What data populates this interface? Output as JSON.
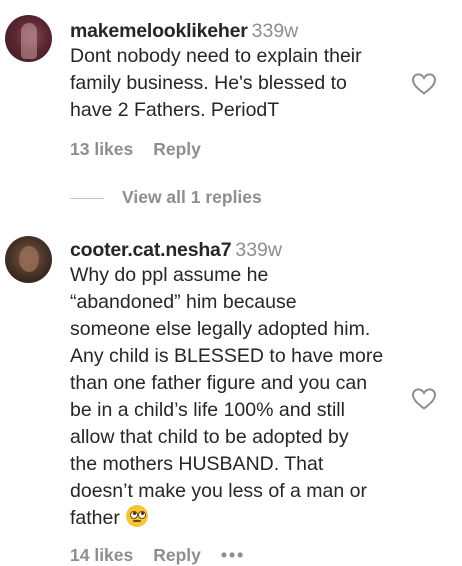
{
  "comments": [
    {
      "username": "makemelooklikeher",
      "age": "339w",
      "lines": [
        "Dont nobody need to explain their",
        "family business. He's blessed to",
        "have 2 Fathers. PeriodT"
      ],
      "likes": "13 likes",
      "reply_label": "Reply"
    },
    {
      "username": "cooter.cat.nesha7",
      "age": "339w",
      "lines": [
        "Why do ppl assume he",
        "“abandoned” him because",
        "someone else legally adopted him.",
        "Any child is BLESSED to have more",
        "than one father figure and you can",
        "be in a child’s life 100% and still",
        "allow that child to be adopted by",
        "the mothers HUSBAND. That",
        "doesn’t make you less of a man or",
        "father"
      ],
      "likes": "14 likes",
      "reply_label": "Reply",
      "more_label": "•••",
      "emoji": "face-with-rolling-eyes"
    }
  ],
  "view_replies_label": "View all 1 replies",
  "icons": {
    "like": "heart-outline-icon"
  },
  "colors": {
    "text": "#262626",
    "secondary": "#8e8e8e",
    "background": "#ffffff"
  }
}
